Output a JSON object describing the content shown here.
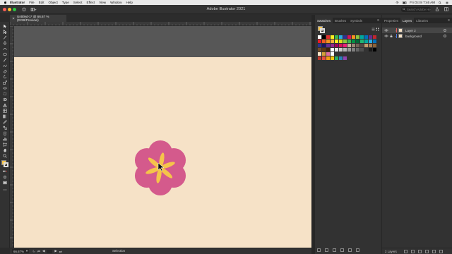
{
  "menubar": {
    "app_menu": "Illustrator",
    "menus": [
      "File",
      "Edit",
      "Object",
      "Type",
      "Select",
      "Effect",
      "View",
      "Window",
      "Help"
    ],
    "clock": "Fri Oct 8  7:46 AM"
  },
  "window": {
    "title": "Adobe Illustrator 2021"
  },
  "search": {
    "placeholder": "Search Adobe Help"
  },
  "document": {
    "tab_label": "Untitled-1* @ 66.67 % (RGB/Preview)"
  },
  "status": {
    "zoom": "66.67%",
    "tool": "Selection"
  },
  "swatches_panel": {
    "tabs": [
      "Swatches",
      "Brushes",
      "Symbols"
    ],
    "rows": [
      [
        "#ffffff",
        "#000000",
        "#e62e2e",
        "#fcee21",
        "#39b54a",
        "#29abe2",
        "#2e3192",
        "#d4145a",
        "#f7931e",
        "#8cc63f",
        "#00a99d",
        "#0071bc",
        "#662d91",
        "#c1272d"
      ],
      [
        "#ed1c24",
        "#f15a24",
        "#f7931e",
        "#fbb03b",
        "#fcee21",
        "#d9e021",
        "#8cc63f",
        "#39b54a",
        "#009245",
        "#006837",
        "#22b573",
        "#00a99d",
        "#29abe2",
        "#0071bc"
      ],
      [
        "#2e3192",
        "#1b1464",
        "#662d91",
        "#93278f",
        "#9e005d",
        "#d4145a",
        "#ed1e79",
        "#c7b299",
        "#998675",
        "#736357",
        "#534741",
        "#c69c6d",
        "#a67c52",
        "#8c6239"
      ],
      [
        "#754c24",
        "#603813",
        "#42210b",
        "#ffffff",
        "#e6e6e6",
        "#cccccc",
        "#b3b3b3",
        "#999999",
        "#808080",
        "#666666",
        "#4d4d4d",
        "#333333",
        "#1a1a1a",
        "#000000"
      ],
      [
        "#f6e2c7",
        "#d4a037",
        "#e06ea0",
        "#ffffff"
      ],
      [
        "#c0392b",
        "#e74c3c",
        "#f39c12",
        "#f1c40f",
        "#27ae60",
        "#2980b9",
        "#8e44ad"
      ]
    ]
  },
  "layers_panel": {
    "tabs": [
      "Properties",
      "Layers",
      "Libraries"
    ],
    "layers": [
      {
        "name": "Layer 2",
        "color": "#e85d5d",
        "selected": true
      },
      {
        "name": "background",
        "color": "#4f7ae0",
        "selected": false
      }
    ],
    "count_label": "2 Layers"
  },
  "artwork": {
    "petal_color": "#d45a8c",
    "stamen_color": "#f5c44a",
    "artboard_color": "#f6e2c7",
    "pasteboard_color": "#575757"
  }
}
